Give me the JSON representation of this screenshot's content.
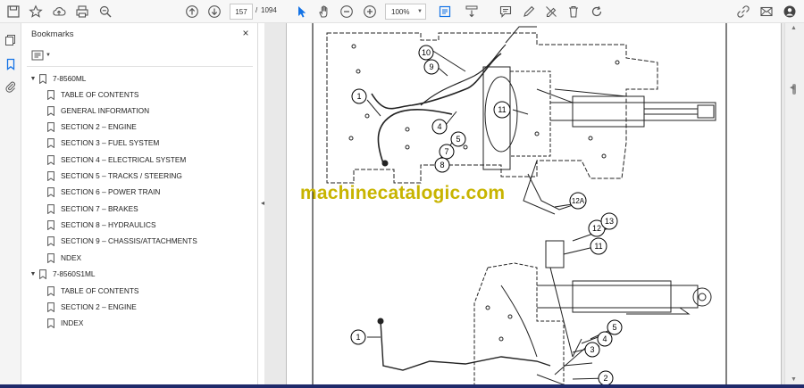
{
  "toolbar": {
    "current_page": "157",
    "page_separator": "/",
    "total_pages": "1094",
    "zoom": "100%"
  },
  "bookmarks_panel": {
    "title": "Bookmarks",
    "close_glyph": "×",
    "items": [
      {
        "label": "7-8560ML",
        "level": 0,
        "expanded": true
      },
      {
        "label": "TABLE OF CONTENTS",
        "level": 1
      },
      {
        "label": "GENERAL INFORMATION",
        "level": 1
      },
      {
        "label": "SECTION 2 – ENGINE",
        "level": 1
      },
      {
        "label": "SECTION 3 – FUEL SYSTEM",
        "level": 1
      },
      {
        "label": "SECTION 4 – ELECTRICAL SYSTEM",
        "level": 1
      },
      {
        "label": "SECTION 5 – TRACKS / STEERING",
        "level": 1
      },
      {
        "label": "SECTION 6 – POWER TRAIN",
        "level": 1
      },
      {
        "label": "SECTION 7 – BRAKES",
        "level": 1
      },
      {
        "label": "SECTION 8 – HYDRAULICS",
        "level": 1
      },
      {
        "label": "SECTION 9 – CHASSIS/ATTACHMENTS",
        "level": 1
      },
      {
        "label": "NDEX",
        "level": 1
      },
      {
        "label": "7-8560S1ML",
        "level": 0,
        "expanded": true
      },
      {
        "label": "TABLE OF CONTENTS",
        "level": 1
      },
      {
        "label": "SECTION 2 – ENGINE",
        "level": 1
      },
      {
        "label": "INDEX",
        "level": 1
      }
    ]
  },
  "document": {
    "watermark": "machinecatalogic.com",
    "callouts_top": [
      "1",
      "4",
      "5",
      "7",
      "8",
      "9",
      "10",
      "11",
      "12A"
    ],
    "callouts_bottom": [
      "1",
      "2",
      "3",
      "4",
      "5",
      "11",
      "12",
      "13"
    ]
  },
  "colors": {
    "watermark": "#c8b400",
    "selected_tool": "#1473e6",
    "bottom_bar": "#1f2a6a"
  }
}
